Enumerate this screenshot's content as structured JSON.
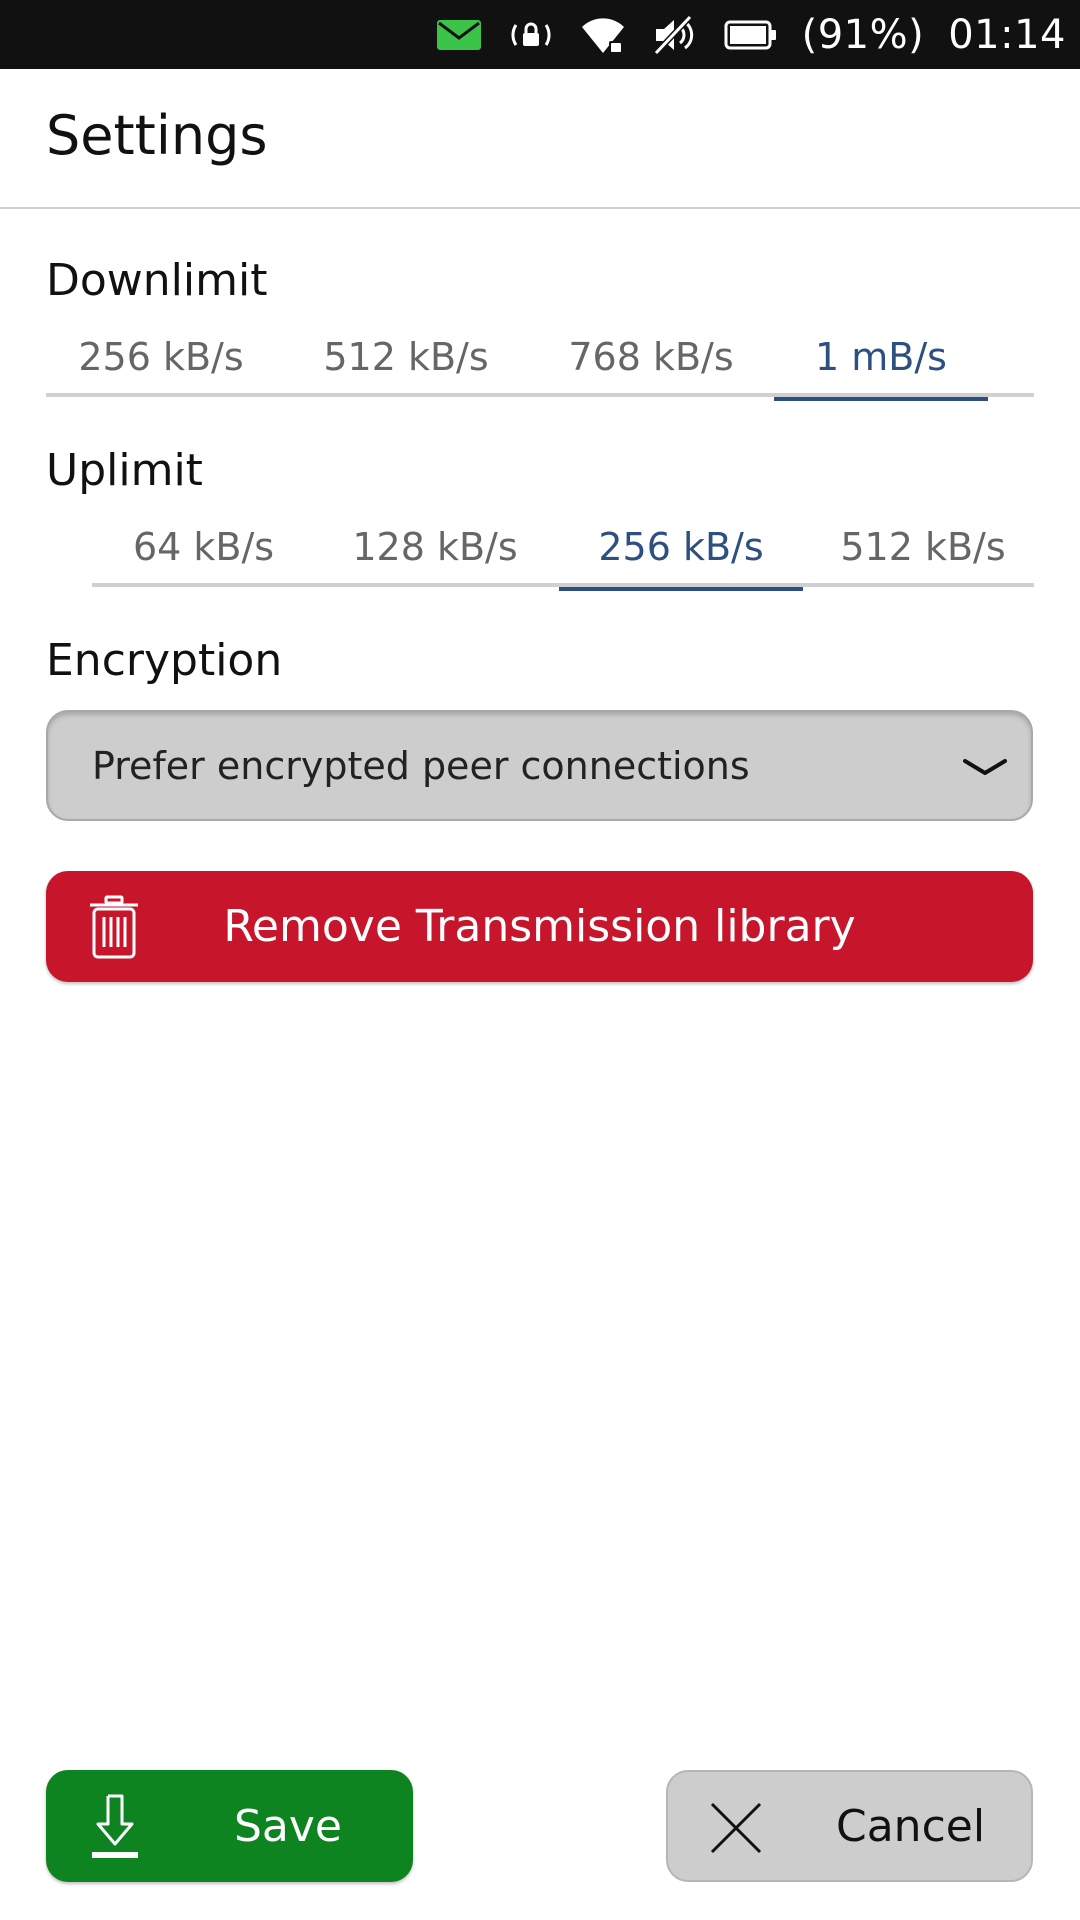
{
  "status_bar": {
    "icons": [
      "mail-icon",
      "rotation-lock-icon",
      "wifi-icon",
      "muted-speaker-icon",
      "battery-icon"
    ],
    "battery_percent_text": "(91%)",
    "time": "01:14",
    "colors": {
      "background": "#111111",
      "mail": "#3cc44a"
    }
  },
  "header": {
    "title": "Settings"
  },
  "downlimit": {
    "label": "Downlimit",
    "options": [
      "256 kB/s",
      "512 kB/s",
      "768 kB/s",
      "1 mB/s"
    ],
    "selected": "1 mB/s"
  },
  "uplimit": {
    "label": "Uplimit",
    "options": [
      "64 kB/s",
      "128 kB/s",
      "256 kB/s",
      "512 kB/s"
    ],
    "selected": "256 kB/s"
  },
  "encryption": {
    "label": "Encryption",
    "selected_value": "Prefer encrypted peer connections",
    "icon": "chevron-down-icon"
  },
  "remove_button": {
    "label": "Remove Transmission library",
    "icon": "trash-icon",
    "color": "#c7162b"
  },
  "footer": {
    "save": {
      "label": "Save",
      "icon": "download-icon",
      "color": "#0e8420"
    },
    "cancel": {
      "label": "Cancel",
      "icon": "close-icon",
      "color": "#cdcdcd"
    }
  },
  "colors": {
    "accent": "#2d4f82",
    "tab_inactive": "#666666"
  }
}
